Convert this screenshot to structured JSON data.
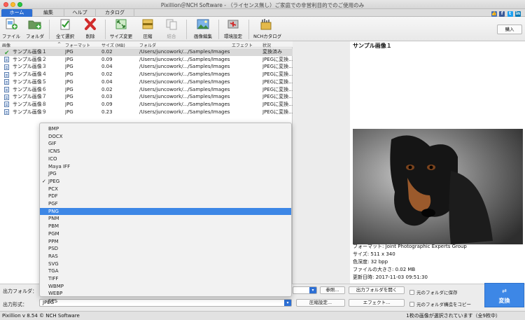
{
  "window": {
    "title": "Pixillion＠NCH Software - （ライセンス無し）ご家庭での非営利目的でのご使用のみ"
  },
  "tabs": [
    {
      "label": "ホーム",
      "active": true
    },
    {
      "label": "編集",
      "active": false
    },
    {
      "label": "ヘルプ",
      "active": false
    },
    {
      "label": "カタログ",
      "active": false
    }
  ],
  "social": [
    "like-icon",
    "facebook-icon",
    "twitter-icon",
    "linkedin-icon"
  ],
  "toolbar": {
    "file": "ファイル",
    "folder": "フォルダ",
    "select_all": "全て選択",
    "delete": "削除",
    "resize": "サイズ変更",
    "compress": "圧縮",
    "join": "結合",
    "image_edit": "画像編集",
    "settings": "環境設定",
    "nch_catalog": "NCHカタログ",
    "buy": "購入"
  },
  "list": {
    "headers": {
      "image": "画像",
      "format": "フォーマット",
      "size": "サイズ (MB)",
      "folder": "フォルダ",
      "effect": "エフェクト",
      "status": "状況"
    },
    "rows": [
      {
        "name": "サンプル画像１",
        "format": "JPG",
        "size": "0.02",
        "folder": "/Users/juncowork/.../Samples/Images",
        "status": "変換済み",
        "done": true
      },
      {
        "name": "サンプル画像２",
        "format": "JPG",
        "size": "0.09",
        "folder": "/Users/juncowork/.../Samples/Images",
        "status": "JPEGに変換…値",
        "done": false
      },
      {
        "name": "サンプル画像３",
        "format": "JPG",
        "size": "0.04",
        "folder": "/Users/juncowork/.../Samples/Images",
        "status": "JPEGに変換…値",
        "done": false
      },
      {
        "name": "サンプル画像４",
        "format": "JPG",
        "size": "0.02",
        "folder": "/Users/juncowork/.../Samples/Images",
        "status": "JPEGに変換…値",
        "done": false
      },
      {
        "name": "サンプル画像５",
        "format": "JPG",
        "size": "0.04",
        "folder": "/Users/juncowork/.../Samples/Images",
        "status": "JPEGに変換…値",
        "done": false
      },
      {
        "name": "サンプル画像６",
        "format": "JPG",
        "size": "0.02",
        "folder": "/Users/juncowork/.../Samples/Images",
        "status": "JPEGに変換…値",
        "done": false
      },
      {
        "name": "サンプル画像７",
        "format": "JPG",
        "size": "0.03",
        "folder": "/Users/juncowork/.../Samples/Images",
        "status": "JPEGに変換…値",
        "done": false
      },
      {
        "name": "サンプル画像８",
        "format": "JPG",
        "size": "0.09",
        "folder": "/Users/juncowork/.../Samples/Images",
        "status": "JPEGに変換…値",
        "done": false
      },
      {
        "name": "サンプル画像９",
        "format": "JPG",
        "size": "0.23",
        "folder": "/Users/juncowork/.../Samples/Images",
        "status": "JPEGに変換…値",
        "done": false
      }
    ]
  },
  "preview": {
    "title": "サンプル画像１",
    "info": [
      "フォーマット: Joint Photographic Experts Group",
      "サイズ: 511 x 340",
      "色深度: 32 bpp",
      "ファイルの大きさ: 0.02 MB",
      "更新日時: 2017-11-03 09:51:30"
    ]
  },
  "dropdown": {
    "options": [
      "BMP",
      "DOCX",
      "GIF",
      "ICNS",
      "ICO",
      "Maya IFF",
      "JPG",
      "JPEG",
      "PCX",
      "PDF",
      "PGF",
      "PNG",
      "PNM",
      "PBM",
      "PGM",
      "PPM",
      "PSD",
      "RAS",
      "SVG",
      "TGA",
      "TIFF",
      "WBMP",
      "WEBP",
      "EPS"
    ],
    "checked": "JPEG",
    "highlighted": "PNG"
  },
  "bottom": {
    "output_folder_label": "出力フォルダ：",
    "output_format_label": "出力形式：",
    "output_format_value": "JPEG",
    "browse": "参照...",
    "open_output_folder": "出力フォルダを開く",
    "compression_settings": "圧縮設定...",
    "effects": "エフェクト...",
    "save_to_original": "元のフォルダに保存",
    "copy_folder_structure": "元のフォルダ構造をコピー",
    "convert": "変換"
  },
  "status": {
    "left": "Pixillion v 8.54 © NCH Software",
    "right": "1枚の画像が選択されています（全9枚中）"
  }
}
